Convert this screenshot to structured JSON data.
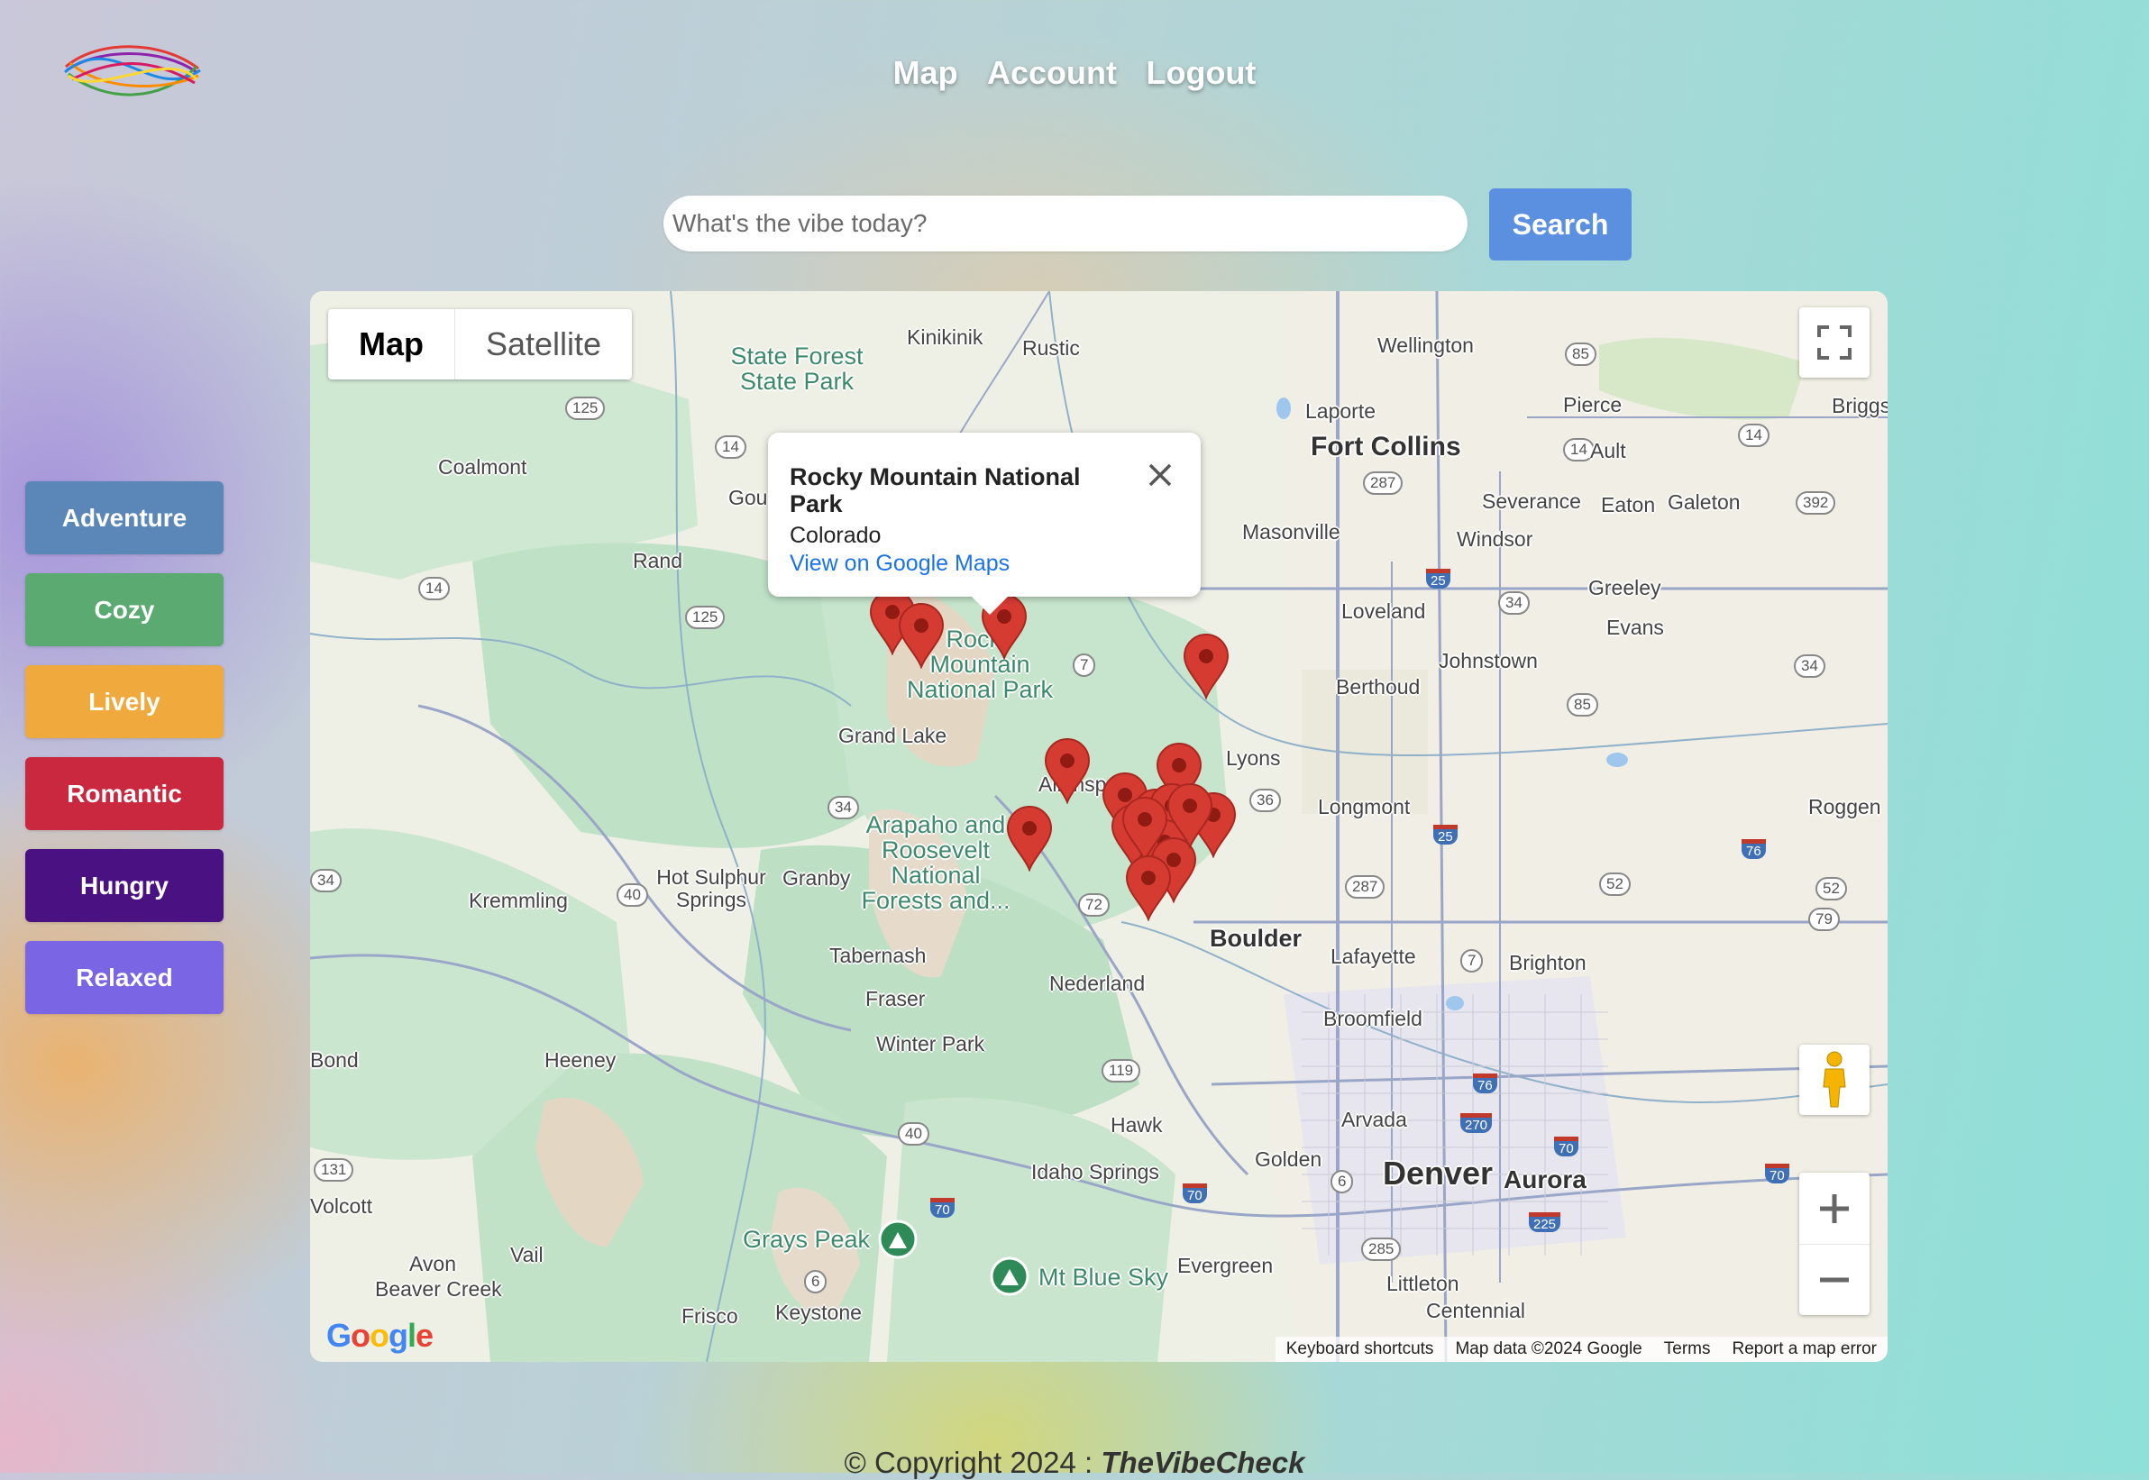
{
  "nav": {
    "items": [
      "Map",
      "Account",
      "Logout"
    ]
  },
  "search": {
    "placeholder": "What's the vibe today?",
    "value": "",
    "button_label": "Search"
  },
  "vibes": [
    {
      "label": "Adventure",
      "color": "#5b87b8"
    },
    {
      "label": "Cozy",
      "color": "#5aaa72"
    },
    {
      "label": "Lively",
      "color": "#f0a93c"
    },
    {
      "label": "Romantic",
      "color": "#c9283f"
    },
    {
      "label": "Hungry",
      "color": "#4a1183"
    },
    {
      "label": "Relaxed",
      "color": "#7a65e4"
    }
  ],
  "map": {
    "type_control": {
      "map_label": "Map",
      "satellite_label": "Satellite",
      "selected": "Map"
    },
    "popup": {
      "title": "Rocky Mountain National Park",
      "subtitle": "Colorado",
      "link": "View on Google Maps"
    },
    "labels": {
      "towns": [
        "Kinikinik",
        "Rustic",
        "Wellington",
        "Laporte",
        "Pierce",
        "Briggs",
        "Coalmont",
        "Ault",
        "Severance",
        "Eaton",
        "Galeton",
        "Masonville",
        "Windsor",
        "Rand",
        "Greeley",
        "Loveland",
        "Evans",
        "Johnstown",
        "Berthoud",
        "Grand Lake",
        "Lyons",
        "Allenspark",
        "Longmont",
        "Roggen",
        "Kremmling",
        "Hot Sulphur Springs",
        "Granby",
        "Tabernash",
        "Fraser",
        "Lafayette",
        "Brighton",
        "Nederland",
        "Broomfield",
        "Winter Park",
        "Heeney",
        "Arvada",
        "Hawk",
        "Golden",
        "Idaho Springs",
        "Vail",
        "Avon",
        "Beaver Creek",
        "Evergreen",
        "Littleton",
        "Centennial",
        "Frisco",
        "Keystone",
        "Volcott",
        "Bond",
        "Gou"
      ],
      "cities": [
        "Fort Collins",
        "Denver",
        "Aurora",
        "Boulder"
      ],
      "parks": [
        "State Forest State Park",
        "Rocky Mountain National Park",
        "Arapaho and Roosevelt National Forests and...",
        "Grays Peak",
        "Mt Blue Sky"
      ]
    },
    "attribution": {
      "google": "Google",
      "shortcuts": "Keyboard shortcuts",
      "data": "Map data ©2024 Google",
      "terms": "Terms",
      "report": "Report a map error"
    },
    "marker_color": "#d63b32"
  },
  "footer": {
    "prefix": "© Copyright 2024 : ",
    "brand": "TheVibeCheck"
  }
}
